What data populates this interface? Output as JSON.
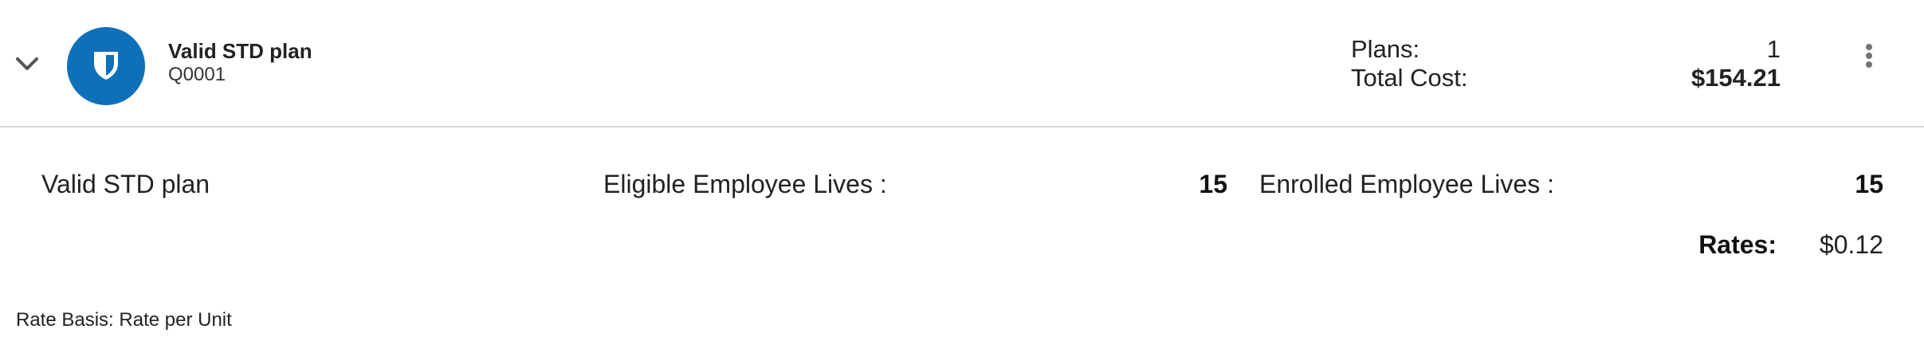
{
  "header": {
    "plan_name": "Valid STD plan",
    "plan_code": "Q0001",
    "plans_label": "Plans:",
    "plans_count": "1",
    "total_cost_label": "Total Cost:",
    "total_cost_value": "$154.21",
    "avatar_icon": "shield-icon",
    "avatar_color": "#0e70b8"
  },
  "details": {
    "plan_name": "Valid STD plan",
    "eligible_label": "Eligible Employee Lives :",
    "eligible_value": "15",
    "enrolled_label": "Enrolled Employee Lives :",
    "enrolled_value": "15",
    "rates_label": "Rates:",
    "rates_value": "$0.12"
  },
  "footer": {
    "rate_basis": "Rate Basis: Rate per Unit"
  }
}
